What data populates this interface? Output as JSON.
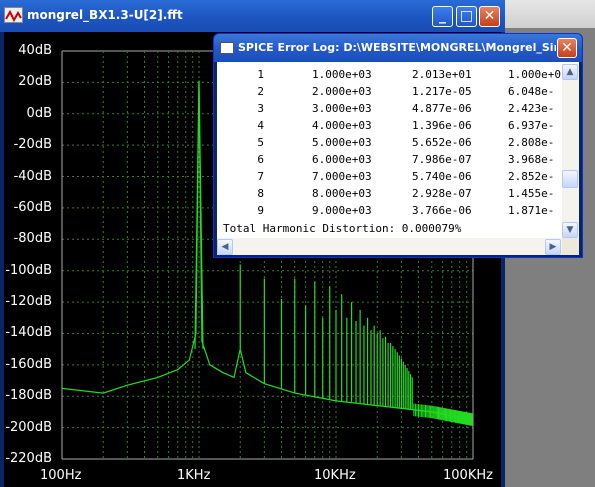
{
  "fft_window": {
    "title": "mongrel_BX1.3-U[2].fft",
    "buttons": {
      "minimize": "_",
      "maximize": "□",
      "close": "✕"
    }
  },
  "log_window": {
    "title": "SPICE Error Log: D:\\WEBSITE\\MONGREL\\Mongrel_Simulatio...",
    "close": "✕",
    "rows": [
      [
        "1",
        "1.000e+03",
        "2.013e+01",
        "1.000e+0"
      ],
      [
        "2",
        "2.000e+03",
        "1.217e-05",
        "6.048e-"
      ],
      [
        "3",
        "3.000e+03",
        "4.877e-06",
        "2.423e-"
      ],
      [
        "4",
        "4.000e+03",
        "1.396e-06",
        "6.937e-"
      ],
      [
        "5",
        "5.000e+03",
        "5.652e-06",
        "2.808e-"
      ],
      [
        "6",
        "6.000e+03",
        "7.986e-07",
        "3.968e-"
      ],
      [
        "7",
        "7.000e+03",
        "5.740e-06",
        "2.852e-"
      ],
      [
        "8",
        "8.000e+03",
        "2.928e-07",
        "1.455e-"
      ],
      [
        "9",
        "9.000e+03",
        "3.766e-06",
        "1.871e-"
      ]
    ],
    "thd": "Total Harmonic Distortion: 0.000079%"
  },
  "chart_data": {
    "type": "line",
    "title": "",
    "xscale": "log",
    "xlim": [
      100,
      100000
    ],
    "ylim": [
      -220,
      40
    ],
    "y_ticks": [
      "40dB",
      "20dB",
      "0dB",
      "-20dB",
      "-40dB",
      "-60dB",
      "-80dB",
      "-100dB",
      "-120dB",
      "-140dB",
      "-160dB",
      "-180dB",
      "-200dB",
      "-220dB"
    ],
    "x_ticks": [
      "100Hz",
      "1KHz",
      "10KHz",
      "100KHz"
    ],
    "grid": true,
    "colors": {
      "trace": "#22dd22",
      "grid": "#3a7a3a",
      "background": "#000000"
    },
    "series": [
      {
        "color": "#22dd22",
        "noise_floor": [
          [
            100,
            -175
          ],
          [
            200,
            -178
          ],
          [
            300,
            -173
          ],
          [
            500,
            -168
          ],
          [
            700,
            -163
          ],
          [
            850,
            -157
          ],
          [
            950,
            -140
          ],
          [
            1000,
            21
          ],
          [
            1050,
            -145
          ],
          [
            1200,
            -160
          ],
          [
            1500,
            -165
          ],
          [
            1800,
            -168
          ],
          [
            2000,
            -150
          ],
          [
            2200,
            -165
          ],
          [
            3000,
            -172
          ],
          [
            5000,
            -178
          ],
          [
            10000,
            -183
          ],
          [
            20000,
            -186
          ],
          [
            50000,
            -190
          ],
          [
            100000,
            -195
          ]
        ],
        "harmonics": [
          [
            2000,
            -96
          ],
          [
            3000,
            -105
          ],
          [
            4000,
            -118
          ],
          [
            5000,
            -105
          ],
          [
            6000,
            -122
          ],
          [
            7000,
            -107
          ],
          [
            8000,
            -130
          ],
          [
            9000,
            -110
          ],
          [
            10000,
            -125
          ],
          [
            11000,
            -115
          ],
          [
            12000,
            -130
          ],
          [
            13000,
            -120
          ],
          [
            14000,
            -132
          ],
          [
            15000,
            -125
          ],
          [
            16000,
            -135
          ],
          [
            17000,
            -130
          ],
          [
            18000,
            -138
          ],
          [
            19000,
            -135
          ],
          [
            20000,
            -140
          ],
          [
            21000,
            -138
          ],
          [
            22000,
            -143
          ],
          [
            23000,
            -142
          ],
          [
            24000,
            -146
          ],
          [
            25000,
            -146
          ],
          [
            26000,
            -148
          ],
          [
            27000,
            -150
          ],
          [
            28000,
            -152
          ],
          [
            29000,
            -154
          ],
          [
            30000,
            -156
          ],
          [
            31000,
            -158
          ],
          [
            32000,
            -160
          ],
          [
            33000,
            -162
          ],
          [
            34000,
            -164
          ],
          [
            35000,
            -166
          ],
          [
            36000,
            -168
          ]
        ]
      }
    ]
  }
}
